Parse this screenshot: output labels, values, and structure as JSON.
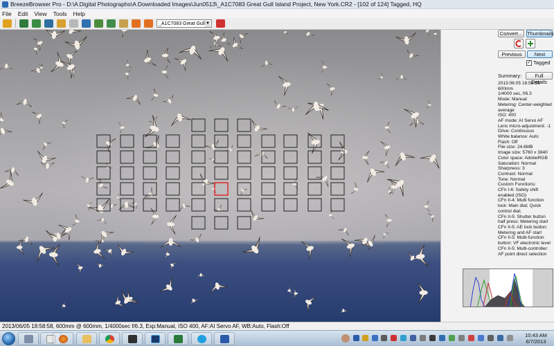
{
  "window": {
    "title": "BreezeBrowser Pro - D:\\A Digital Photographs\\A Downloaded Images\\Jun0513\\_A1C7083  Great Gull Island Project, New York.CR2 - [102 of 124] Tagged, HQ"
  },
  "menu": [
    "File",
    "Edit",
    "View",
    "Tools",
    "Help"
  ],
  "toolbar": {
    "file_select_value": "_A1C7083  Great Gull Is"
  },
  "panel": {
    "convert_label": "Convert...",
    "thumbnails_label": "Thumbnails",
    "previous_label": "Previous",
    "next_label": "Next",
    "tagged_label": "Tagged",
    "tagged_checked": true,
    "summary_label": "Summary:",
    "full_details_label": "Full Details",
    "details": [
      "2013:06:05 18:58:58",
      "600mm",
      "1/4000 sec, f/6.3",
      "Mode: Manual",
      "Metering: Center-weighted average",
      "ISO: 400",
      "AF mode: AI Servo AF",
      "Lens micro-adjustment: -1",
      "Drive: Continuous",
      "White balance: Auto",
      "Flash: Off",
      "File size: 24.6MB",
      "Image size: 5760 x 3840",
      "Color space: AdobeRGB",
      "Saturation: Normal",
      "Sharpness: 3",
      "Contrast: Normal",
      "Tone: Normal",
      "Custom Functions:",
      "CFn I-6: Safety shift enabled (ISO)",
      "CFn II-4: Multi function lock: Main dial; Quick control dial;",
      "CFn II-5: Shutter button half press: Metering start",
      "CFn II-5: AE lock button: Metering and AF start",
      "CFn II-5: Multi-function button: VF electronic level",
      "CFn II-5: Multi-controller: AF point direct selection"
    ]
  },
  "statusbar": {
    "text": "2013/06/05 18:58:58, 600mm @ 600mm, 1/4000sec f/6.3, Exp:Manual, ISO 400, AF:AI Servo AF, WB:Auto, Flash:Off"
  },
  "taskbar": {
    "time": "10:43 AM",
    "date": "6/7/2013"
  },
  "colors": {
    "af_point_selected": "#e02020",
    "sea": "#2a3f72",
    "sky": "#a6a5a8"
  }
}
